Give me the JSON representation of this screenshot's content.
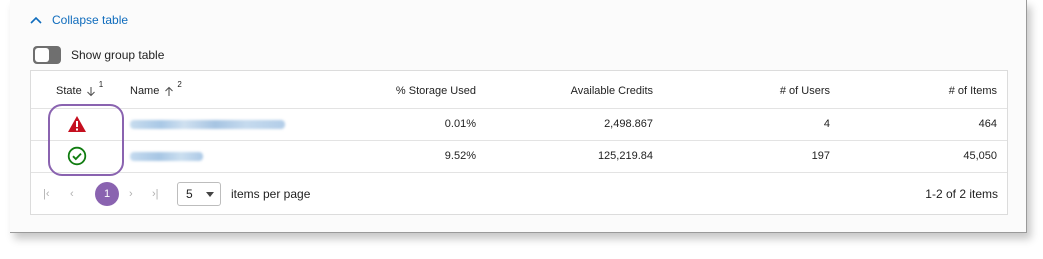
{
  "collapse_label": "Collapse table",
  "toggle_label": "Show group table",
  "columns": {
    "state": "State",
    "state_sort_order": "1",
    "name": "Name",
    "name_sort_order": "2",
    "storage": "% Storage Used",
    "credits": "Available Credits",
    "users": "# of Users",
    "items": "# of Items"
  },
  "rows": [
    {
      "state_icon": "warning-icon",
      "storage": "0.01%",
      "credits": "2,498.867",
      "users": "4",
      "items": "464"
    },
    {
      "state_icon": "check-circle-icon",
      "storage": "9.52%",
      "credits": "125,219.84",
      "users": "197",
      "items": "45,050"
    }
  ],
  "pagination": {
    "current_page": "1",
    "page_size": "5",
    "items_per_page_label": "items per page",
    "range_text": "1-2 of 2 items"
  },
  "colors": {
    "link": "#0f6cbd",
    "accent": "#8a63b0",
    "warning": "#c50f1f",
    "success": "#107c10"
  }
}
